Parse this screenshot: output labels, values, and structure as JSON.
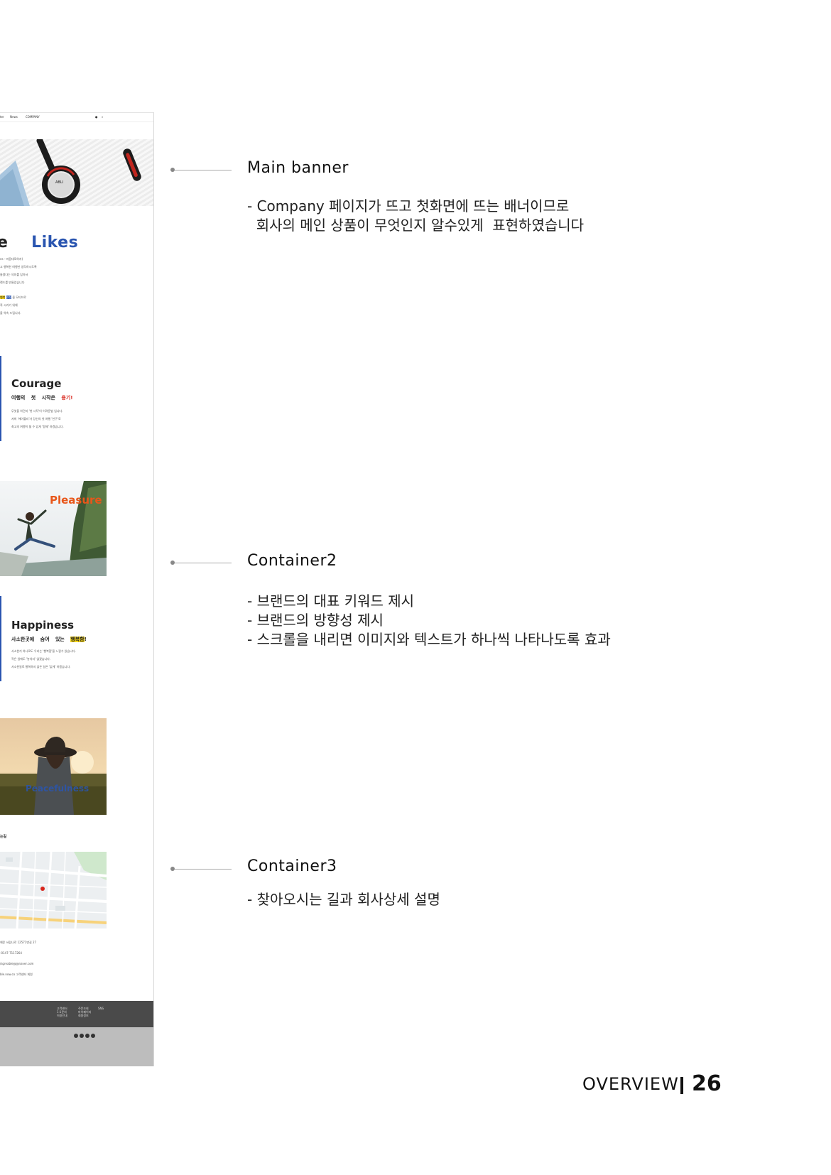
{
  "mockup": {
    "nav": {
      "item1": "ter",
      "item2": "News",
      "item3": "COMPANY"
    },
    "likes": {
      "prefix": "e",
      "word": "Likes"
    },
    "intro_lines": [
      "es - 마음대로하자)",
      "고 행복한 여행만 생각하시도록",
      "들겠다는 의미를 담아서",
      "랜드를 만들었습니다"
    ],
    "motto": {
      "highlight_yellow": "행복",
      "highlight_blue": "안정",
      "tail": "을 모티브로",
      "line2": "족 시키기 위해",
      "line3": "을 약속 드립니다."
    },
    "courage": {
      "title": "Courage",
      "sub_a": "여행의",
      "sub_b": "첫",
      "sub_c": "시작은",
      "sub_red": "용기!",
      "lines": [
        "무엇을 하던지 '첫 시작'이 어려운법 입니다.",
        "저희 '에이블리'가 당신의 첫 여행 '친구'로",
        "최고의 여행이 될 수 있게 '함께' 하겠습니다."
      ]
    },
    "pleasure": {
      "label": "Pleasure"
    },
    "happiness": {
      "title": "Happiness",
      "sub_a": "사소한곳에",
      "sub_b": "숨어",
      "sub_c": "있는",
      "sub_yellow": "행복함",
      "sub_end": "!",
      "lines": [
        "사소한거 하나로도 우리는 '행복함'을 느낄수 있습니다.",
        "작은 일에도 '놓치지' 않겠습니다.",
        "사소한일로 행복하지 않은 일은 '없게' 하겠습니다."
      ]
    },
    "peacefulness": {
      "label": "Peacefulness"
    },
    "directions": {
      "heading": "는길"
    },
    "contact_lines": [
      "해운 서림나로 12571번길 27",
      "-0147-7117264",
      "/sgreable@@naver.com",
      "ble.now.co    고객센터    회원"
    ],
    "footer_cols": [
      [
        "고객센터",
        "1:1문의",
        "이용안내"
      ],
      [
        "주문조회",
        "마이페이지",
        "회원정보"
      ],
      [
        "SNS"
      ]
    ]
  },
  "annotations": [
    {
      "title": "Main banner",
      "lines": [
        "- Company 페이지가 뜨고 첫화면에 뜨는 배너이므로",
        "  회사의 메인 상품이 무엇인지 알수있게  표현하였습니다"
      ]
    },
    {
      "title": "Container2",
      "lines": [
        "- 브랜드의 대표 키워드 제시",
        "- 브랜드의 방향성 제시",
        "- 스크롤을 내리면 이미지와 텍스트가 하나씩 나타나도록 효과"
      ]
    },
    {
      "title": "Container3",
      "lines": [
        "- 찾아오시는 길과 회사상세 설명"
      ]
    }
  ],
  "footer": {
    "label": "OVERVIEW",
    "page": "26"
  },
  "colors": {
    "brand_blue": "#2a55b0",
    "accent_red": "#d8261c",
    "accent_yellow": "#f3d31a",
    "pleasure_orange": "#e8561a"
  }
}
